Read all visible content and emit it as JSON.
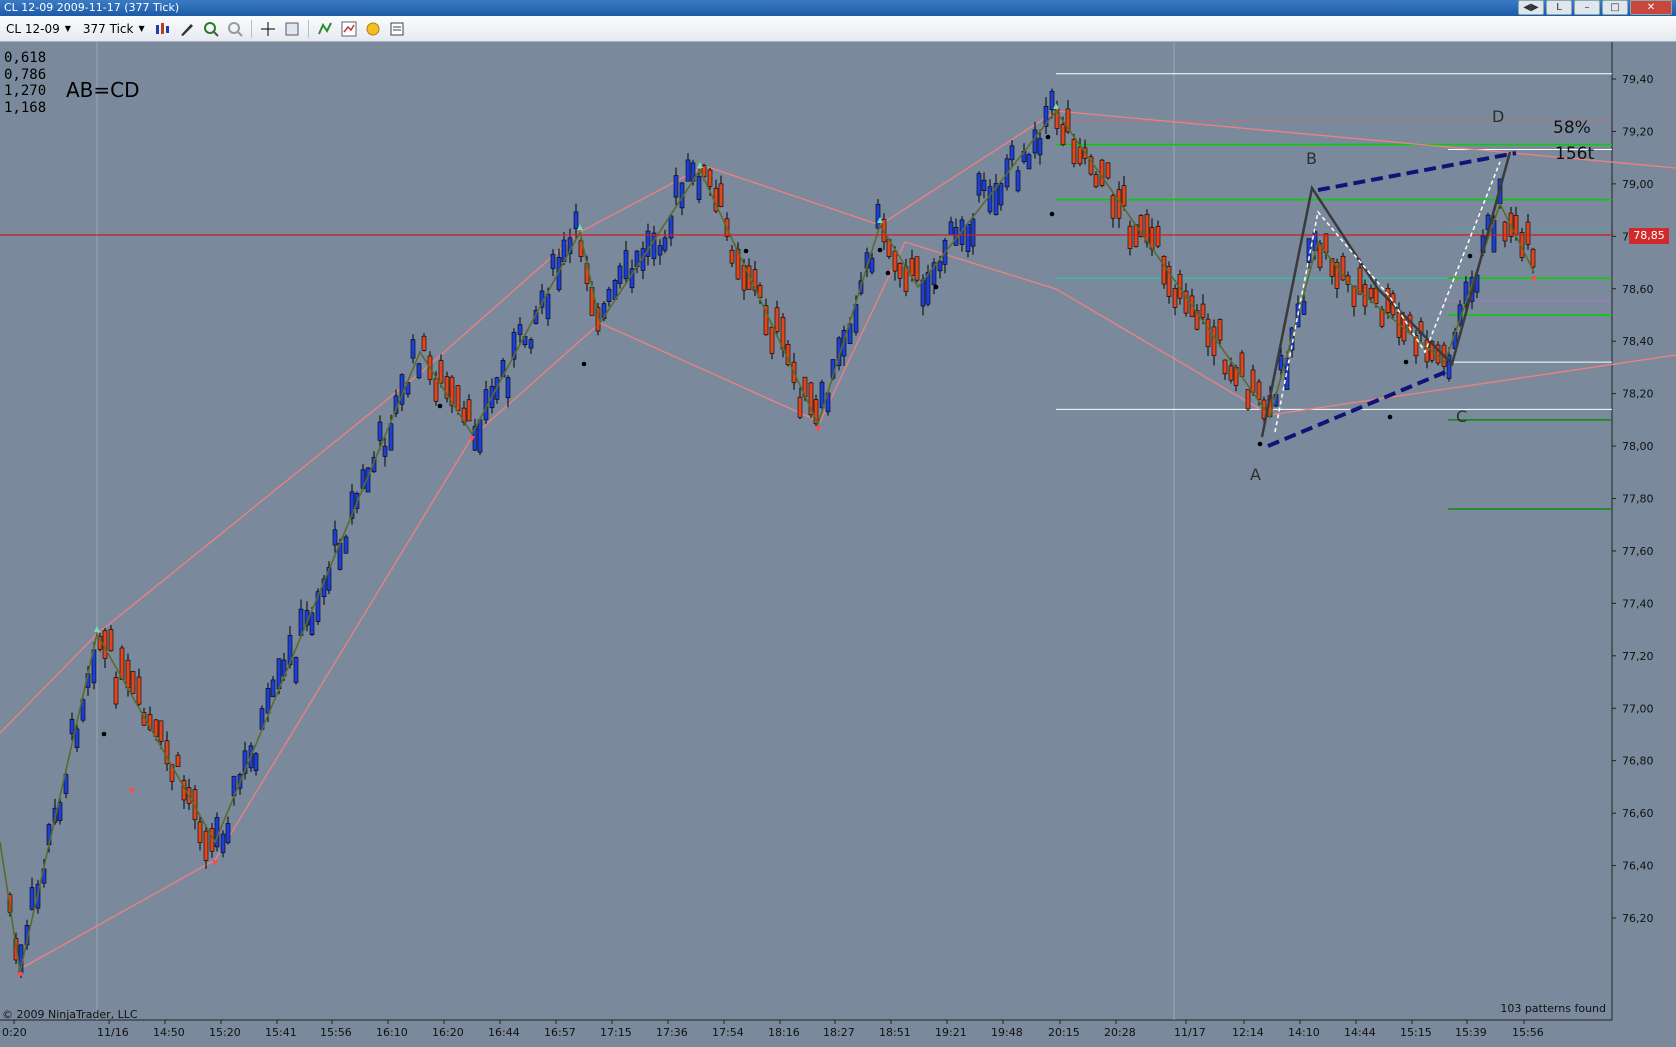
{
  "window": {
    "title": "CL 12-09  2009-11-17 (377 Tick)",
    "buttons": [
      "◀▶",
      "L",
      "–",
      "□",
      "✕"
    ]
  },
  "toolbar": {
    "instrument": "CL 12-09",
    "interval": "377 Tick"
  },
  "chart": {
    "fib_levels": [
      "0,618",
      "0,786",
      "1,270",
      "1,168"
    ],
    "pattern_title": "AB=CD",
    "last_price": "78,85",
    "copyright": "© 2009 NinjaTrader, LLC",
    "status": "103 patterns found",
    "point_labels": {
      "A": "A",
      "B": "B",
      "C": "C",
      "D": "D"
    },
    "annotation_pct": "58%",
    "annotation_ticks": "156t",
    "y_axis_labels": [
      "79,40",
      "79,20",
      "79,00",
      "78,80",
      "78,60",
      "78,40",
      "78,20",
      "78,00",
      "77,80",
      "77,60",
      "77,40",
      "77,20",
      "77,00",
      "76,80",
      "76,60",
      "76,40",
      "76,20"
    ],
    "x_axis_labels": [
      "0:20",
      "11/16",
      "14:50",
      "15:20",
      "15:41",
      "15:56",
      "16:10",
      "16:20",
      "16:44",
      "16:57",
      "17:15",
      "17:36",
      "17:54",
      "18:16",
      "18:27",
      "18:51",
      "19:21",
      "19:48",
      "20:15",
      "20:28",
      "11/17",
      "12:14",
      "14:10",
      "14:44",
      "15:15",
      "15:39",
      "15:56"
    ],
    "colors": {
      "background": "#7a8a9c",
      "up_candle": "#1e3fd6",
      "down_candle": "#e0461c",
      "zigzag": "#5a6a2a",
      "channel": "#f08080",
      "price_line": "#cc1f1f",
      "pattern_dashed": "#101478",
      "level_green": "#00d100"
    }
  },
  "chart_data": {
    "type": "candlestick",
    "title": "CL 12-09  2009-11-17 (377 Tick)",
    "ylim": [
      76.12,
      79.48
    ],
    "last": 78.85,
    "zigzag_pivots": [
      {
        "x": "0:20",
        "y": 76.16
      },
      {
        "x": "11/16",
        "y": 77.42
      },
      {
        "x": "15:20",
        "y": 76.64
      },
      {
        "x": "16:10",
        "y": 78.52
      },
      {
        "x": "16:44",
        "y": 78.14
      },
      {
        "x": "17:15",
        "y": 78.99
      },
      {
        "x": "17:15",
        "y": 78.55
      },
      {
        "x": "17:36",
        "y": 79.24
      },
      {
        "x": "18:27",
        "y": 78.25
      },
      {
        "x": "18:51",
        "y": 79.04
      },
      {
        "x": "19:21",
        "y": 78.76
      },
      {
        "x": "20:15",
        "y": 79.42
      },
      {
        "x": "12:14",
        "y": 78.12
      },
      {
        "x": "14:10",
        "y": 78.94
      },
      {
        "x": "15:39",
        "y": 78.33
      },
      {
        "x": "15:56",
        "y": 79.13
      }
    ],
    "horizontal_levels": [
      79.42,
      79.24,
      79.15,
      78.94,
      78.85,
      78.64,
      78.5,
      78.32,
      78.14,
      78.1,
      77.76
    ]
  }
}
